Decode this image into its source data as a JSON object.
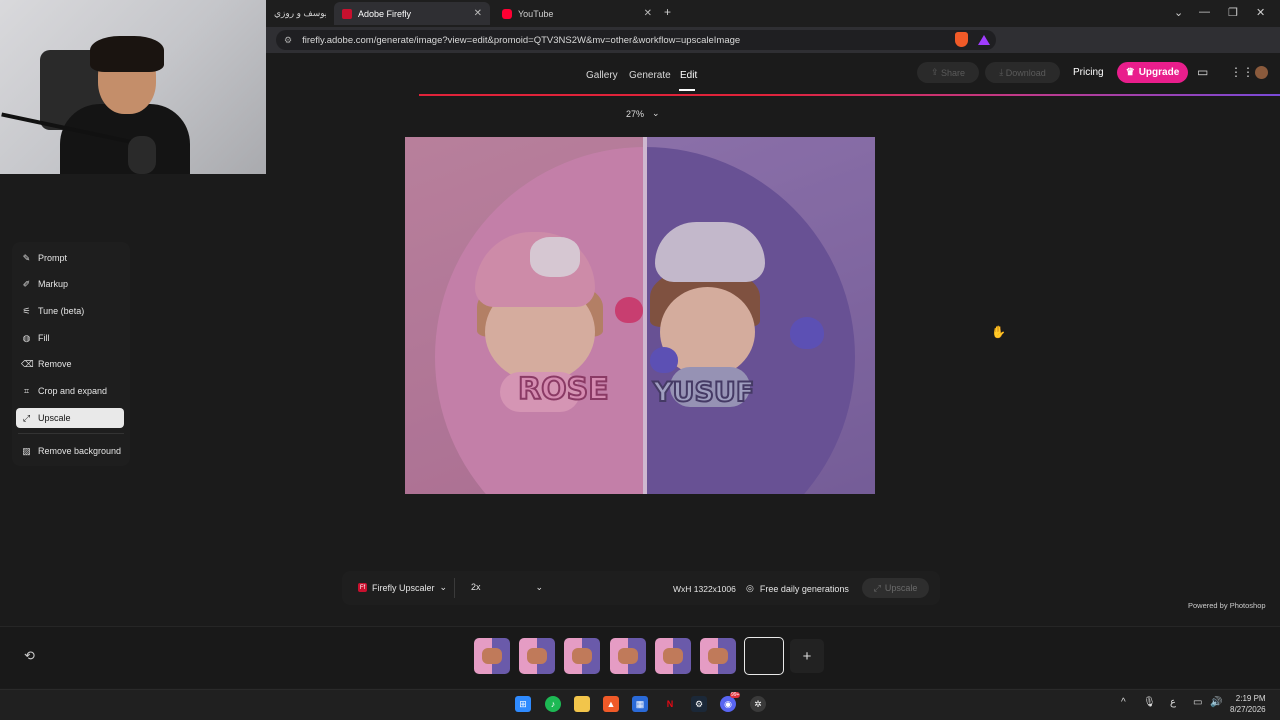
{
  "browser": {
    "tabs": [
      {
        "title": "يوسف و روزي - ..."
      },
      {
        "title": "Adobe Firefly",
        "active": true
      },
      {
        "title": "YouTube"
      }
    ],
    "url": "firefly.adobe.com/generate/image?view=edit&promoid=QTV3NS2W&mv=other&workflow=upscaleImage"
  },
  "header": {
    "nav": [
      {
        "label": "Gallery"
      },
      {
        "label": "Generate"
      },
      {
        "label": "Edit",
        "active": true
      }
    ],
    "share_label": "Share",
    "download_label": "Download",
    "pricing_label": "Pricing",
    "upgrade_label": "Upgrade"
  },
  "canvas": {
    "zoom": "27%",
    "left_name": "ROSE",
    "right_name": "YUSUF"
  },
  "tools": [
    {
      "label": "Prompt",
      "icon": "prompt-icon"
    },
    {
      "label": "Markup",
      "icon": "markup-icon"
    },
    {
      "label": "Tune (beta)",
      "icon": "tune-icon"
    },
    {
      "label": "Fill",
      "icon": "fill-icon"
    },
    {
      "label": "Remove",
      "icon": "remove-icon"
    },
    {
      "label": "Crop and expand",
      "icon": "crop-icon"
    },
    {
      "label": "Upscale",
      "icon": "upscale-icon",
      "active": true
    },
    {
      "label": "Remove background",
      "icon": "remove-background-icon"
    }
  ],
  "upscale_bar": {
    "model_label": "Firefly Upscaler",
    "scale_value": "2x",
    "dimensions": "WxH 1322x1006",
    "free_label": "Free daily generations",
    "upscale_button_label": "Upscale"
  },
  "footer": {
    "powered_by": "Powered by Photoshop"
  },
  "taskbar": {
    "time": "2:19 PM",
    "date": "8/27/2026",
    "discord_badge": "99+"
  },
  "colors": {
    "accent_upgrade": "#e91e8c",
    "firefly_red": "#c8102e",
    "active_tool_bg": "#e9e9e9"
  }
}
